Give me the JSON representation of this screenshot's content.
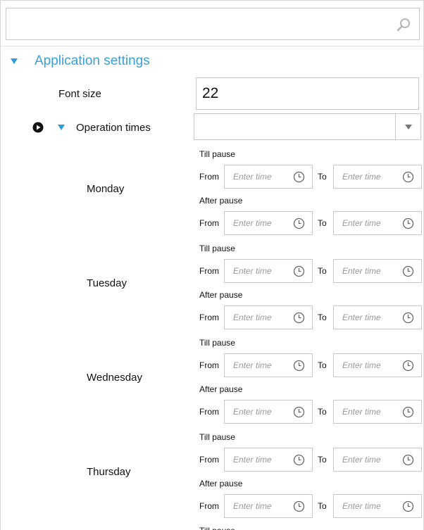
{
  "search": {
    "value": "",
    "placeholder": ""
  },
  "section": {
    "title": "Application settings"
  },
  "font_size": {
    "label": "Font size",
    "value": "22"
  },
  "operation_times": {
    "label": "Operation times",
    "selected": ""
  },
  "labels": {
    "till_pause": "Till pause",
    "after_pause": "After pause",
    "from": "From",
    "to": "To",
    "placeholder": "Enter time"
  },
  "days": [
    "Monday",
    "Tuesday",
    "Wednesday",
    "Thursday"
  ],
  "colors": {
    "accent": "#3aa0d4",
    "border": "#c8c8c8",
    "placeholder": "#9a9a9a"
  }
}
